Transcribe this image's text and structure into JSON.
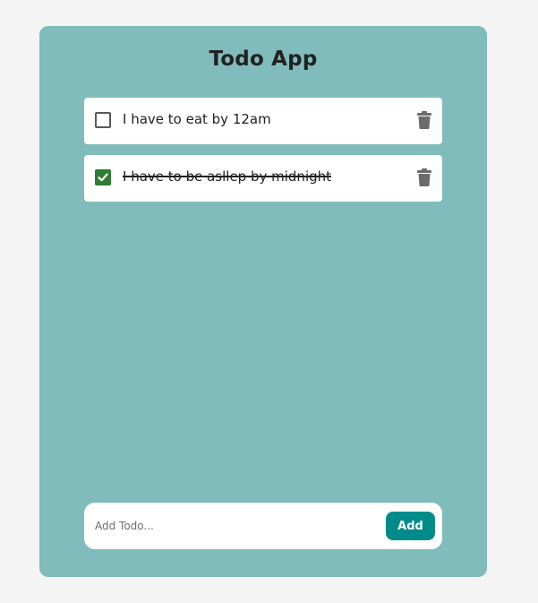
{
  "app": {
    "title": "Todo App"
  },
  "todos": [
    {
      "text": "I have to eat by 12am",
      "completed": false
    },
    {
      "text": "I have to be asllep by midnight",
      "completed": true
    }
  ],
  "add_form": {
    "placeholder": "Add Todo...",
    "value": "",
    "button_label": "Add"
  },
  "icons": {
    "checkbox": "checkbox-icon",
    "delete": "trash-icon"
  },
  "colors": {
    "page_background": "#f4f4f4",
    "card_background": "#80bcbc",
    "item_background": "#ffffff",
    "checked": "#2e7d32",
    "add_button": "#008b8b",
    "trash": "#6b6b6b"
  }
}
